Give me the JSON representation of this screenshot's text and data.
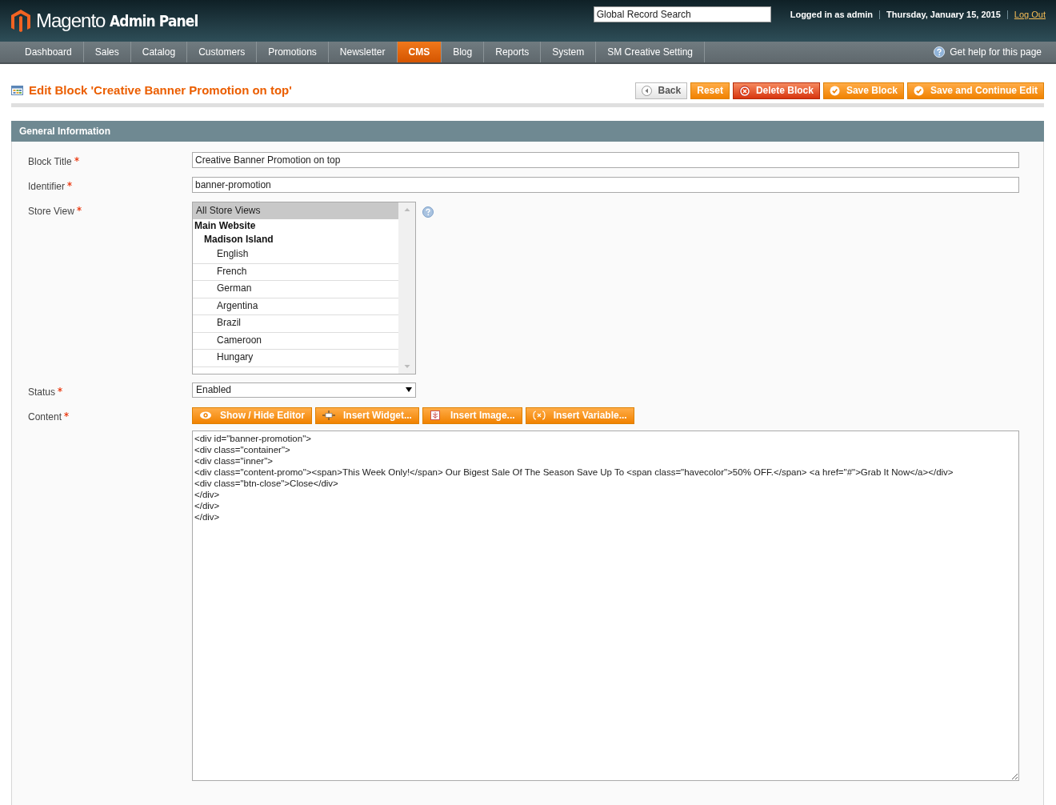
{
  "header": {
    "logo_text": "Magento",
    "logo_suffix": "Admin Panel",
    "search": {
      "value": "Global Record Search"
    },
    "user_info": "Logged in as admin",
    "date": "Thursday, January 15, 2015",
    "logout": "Log Out"
  },
  "nav": {
    "items": [
      {
        "label": "Dashboard",
        "selected": false
      },
      {
        "label": "Sales",
        "selected": false
      },
      {
        "label": "Catalog",
        "selected": false
      },
      {
        "label": "Customers",
        "selected": false
      },
      {
        "label": "Promotions",
        "selected": false
      },
      {
        "label": "Newsletter",
        "selected": false
      },
      {
        "label": "CMS",
        "selected": true
      },
      {
        "label": "Blog",
        "selected": false
      },
      {
        "label": "Reports",
        "selected": false
      },
      {
        "label": "System",
        "selected": false
      },
      {
        "label": "SM Creative Setting",
        "selected": false
      }
    ],
    "help": "Get help for this page"
  },
  "page": {
    "title": "Edit Block 'Creative Banner Promotion on top'",
    "buttons": [
      {
        "label": "Back",
        "kind": "back"
      },
      {
        "label": "Reset",
        "kind": "plain"
      },
      {
        "label": "Delete Block",
        "kind": "delete"
      },
      {
        "label": "Save Block",
        "kind": "save"
      },
      {
        "label": "Save and Continue Edit",
        "kind": "save"
      }
    ]
  },
  "section": {
    "title": "General Information",
    "fields": [
      {
        "kind": "text",
        "label": "Block Title",
        "required": true,
        "value": "Creative Banner Promotion on top"
      },
      {
        "kind": "text",
        "label": "Identifier",
        "required": true,
        "value": "banner-promotion"
      },
      {
        "kind": "multiselect",
        "label": "Store View",
        "required": true,
        "options": [
          {
            "kind": "option",
            "label": "All Store Views",
            "selected": true
          },
          {
            "kind": "group",
            "label": "Main Website",
            "children": [
              {
                "kind": "group",
                "label": "Madison Island",
                "children": [
                  {
                    "kind": "option",
                    "label": "English",
                    "selected": false
                  },
                  {
                    "kind": "option",
                    "label": "French",
                    "selected": false
                  },
                  {
                    "kind": "option",
                    "label": "German",
                    "selected": false
                  },
                  {
                    "kind": "option",
                    "label": "Argentina",
                    "selected": false
                  },
                  {
                    "kind": "option",
                    "label": "Brazil",
                    "selected": false
                  },
                  {
                    "kind": "option",
                    "label": "Cameroon",
                    "selected": false
                  },
                  {
                    "kind": "option",
                    "label": "Hungary",
                    "selected": false
                  }
                ]
              }
            ]
          }
        ]
      },
      {
        "kind": "select",
        "label": "Status",
        "required": true,
        "value": "Enabled"
      },
      {
        "kind": "editor",
        "label": "Content",
        "required": true,
        "buttons": [
          {
            "label": "Show / Hide Editor",
            "kind": "eye"
          },
          {
            "label": "Insert Widget...",
            "kind": "widget"
          },
          {
            "label": "Insert Image...",
            "kind": "image"
          },
          {
            "label": "Insert Variable...",
            "kind": "variable"
          }
        ],
        "value": "<div id=\"banner-promotion\">\n<div class=\"container\">\n<div class=\"inner\">\n<div class=\"content-promo\"><span>This Week Only!</span> Our Bigest Sale Of The Season Save Up To <span class=\"havecolor\">50% OFF.</span> <a href=\"#\">Grab It Now</a></div>\n<div class=\"btn-close\">Close</div>\n</div>\n</div>\n</div>"
      }
    ]
  }
}
